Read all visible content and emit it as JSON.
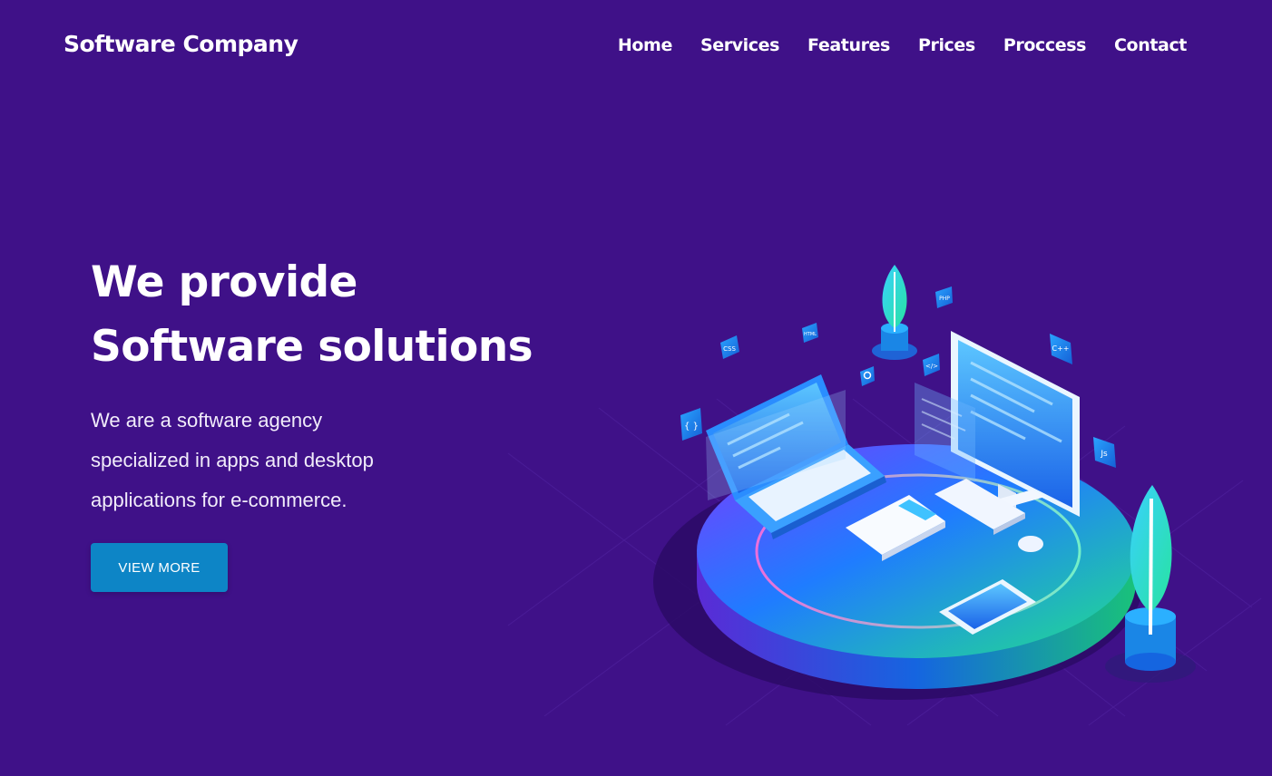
{
  "header": {
    "brand": "Software Company",
    "nav": [
      {
        "label": "Home"
      },
      {
        "label": "Services"
      },
      {
        "label": "Features"
      },
      {
        "label": "Prices"
      },
      {
        "label": "Proccess"
      },
      {
        "label": "Contact"
      }
    ]
  },
  "hero": {
    "title_line1": "We provide",
    "title_line2": "Software solutions",
    "description_line1": "We are a software agency",
    "description_line2": "specialized in apps and desktop",
    "description_line3": "applications for e-commerce.",
    "button_label": "VIEW MORE"
  },
  "illustration": {
    "tags": {
      "css": "CSS",
      "html": "HTML",
      "php": "PHP",
      "code": "</>",
      "cpp": "C++",
      "braces": "{ }",
      "js": "Js"
    }
  },
  "colors": {
    "background": "#3f1188",
    "button": "#0d85c6",
    "platform_start": "#7a3cff",
    "platform_mid": "#1f7cff",
    "platform_end": "#22e08a"
  }
}
